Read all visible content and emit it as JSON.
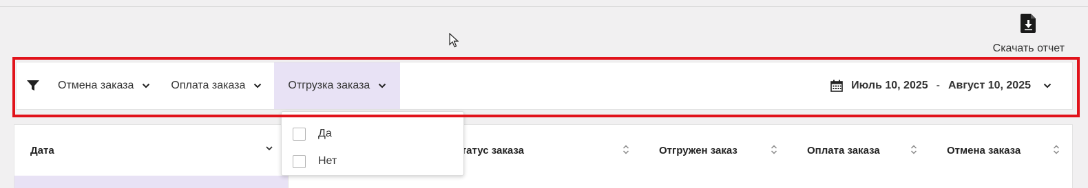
{
  "toolbar": {
    "download_label": "Скачать отчет",
    "download_icon": "download-file-icon"
  },
  "filters": {
    "filter_icon": "filter-funnel-icon",
    "items": [
      {
        "label": "Отмена заказа",
        "active": false
      },
      {
        "label": "Оплата заказа",
        "active": false
      },
      {
        "label": "Отгрузка заказа",
        "active": true
      }
    ],
    "date_range": {
      "calendar_icon": "calendar-icon",
      "start": "Июль 10, 2025",
      "separator": "-",
      "end": "Август 10, 2025"
    }
  },
  "dropdown": {
    "options": [
      {
        "label": "Да",
        "checked": false
      },
      {
        "label": "Нет",
        "checked": false
      }
    ]
  },
  "table": {
    "columns": [
      "Дата",
      "Статус заказа",
      "Отгружен заказ",
      "Оплата заказа",
      "Отмена заказа"
    ]
  },
  "colors": {
    "accent_bg": "#e8e2f5",
    "highlight_border": "#e1131b",
    "page_bg": "#f1f0f1"
  }
}
